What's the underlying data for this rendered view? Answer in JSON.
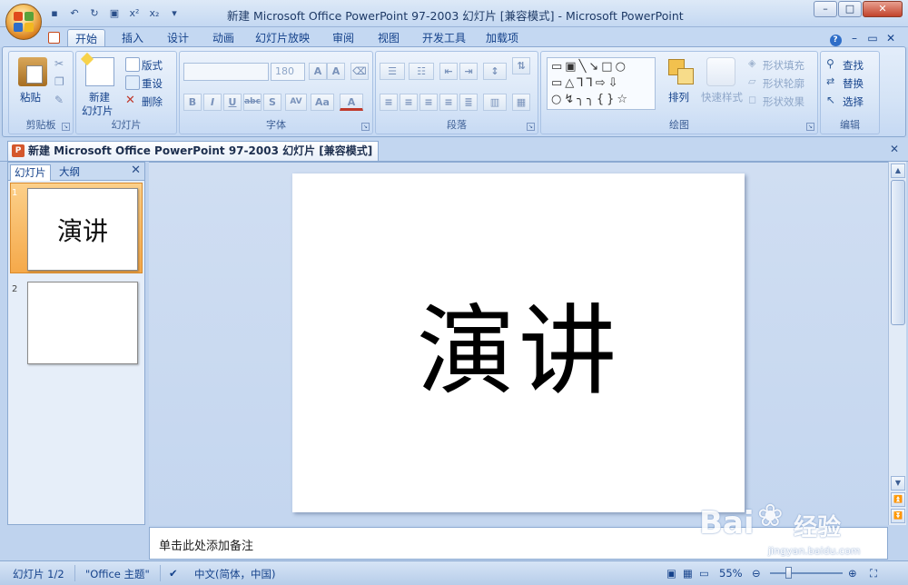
{
  "window": {
    "title": "新建 Microsoft Office PowerPoint 97-2003 幻灯片 [兼容模式] - Microsoft PowerPoint",
    "min_label": "–",
    "max_label": "□",
    "close_label": "✕"
  },
  "ribbon_tabs": [
    "开始",
    "插入",
    "设计",
    "动画",
    "幻灯片放映",
    "审阅",
    "视图",
    "开发工具",
    "加载项"
  ],
  "groups": {
    "clipboard": {
      "label": "剪贴板",
      "paste": "粘贴"
    },
    "slides": {
      "label": "幻灯片",
      "new_slide_line1": "新建",
      "new_slide_line2": "幻灯片",
      "layout": "版式",
      "reset": "重设",
      "delete": "删除"
    },
    "font": {
      "label": "字体",
      "font_name": "",
      "font_size": "180"
    },
    "paragraph": {
      "label": "段落"
    },
    "drawing": {
      "label": "绘图",
      "arrange": "排列",
      "quick_styles": "快速样式",
      "shape_fill": "形状填充",
      "shape_outline": "形状轮廓",
      "shape_effects": "形状效果"
    },
    "editing": {
      "label": "编辑",
      "find": "查找",
      "replace": "替换",
      "select": "选择"
    }
  },
  "document_tab": "新建 Microsoft Office PowerPoint 97-2003 幻灯片 [兼容模式]",
  "left_pane": {
    "tab_slides": "幻灯片",
    "tab_outline": "大纲",
    "slides": [
      {
        "number": "1",
        "text": "演讲"
      },
      {
        "number": "2",
        "text": ""
      }
    ]
  },
  "slide": {
    "text": "演讲"
  },
  "notes_placeholder": "单击此处添加备注",
  "status": {
    "slide_count": "幻灯片 1/2",
    "theme": "\"Office 主题\"",
    "language": "中文(简体，中国)",
    "zoom": "55%"
  },
  "watermark": {
    "brand": "Bai",
    "brand2": "经验",
    "url": "jingyan.baidu.com"
  },
  "colors": {
    "accent": "#15428b",
    "selected_thumb": "#f5a94a",
    "ribbon": "#d4e3f6"
  }
}
